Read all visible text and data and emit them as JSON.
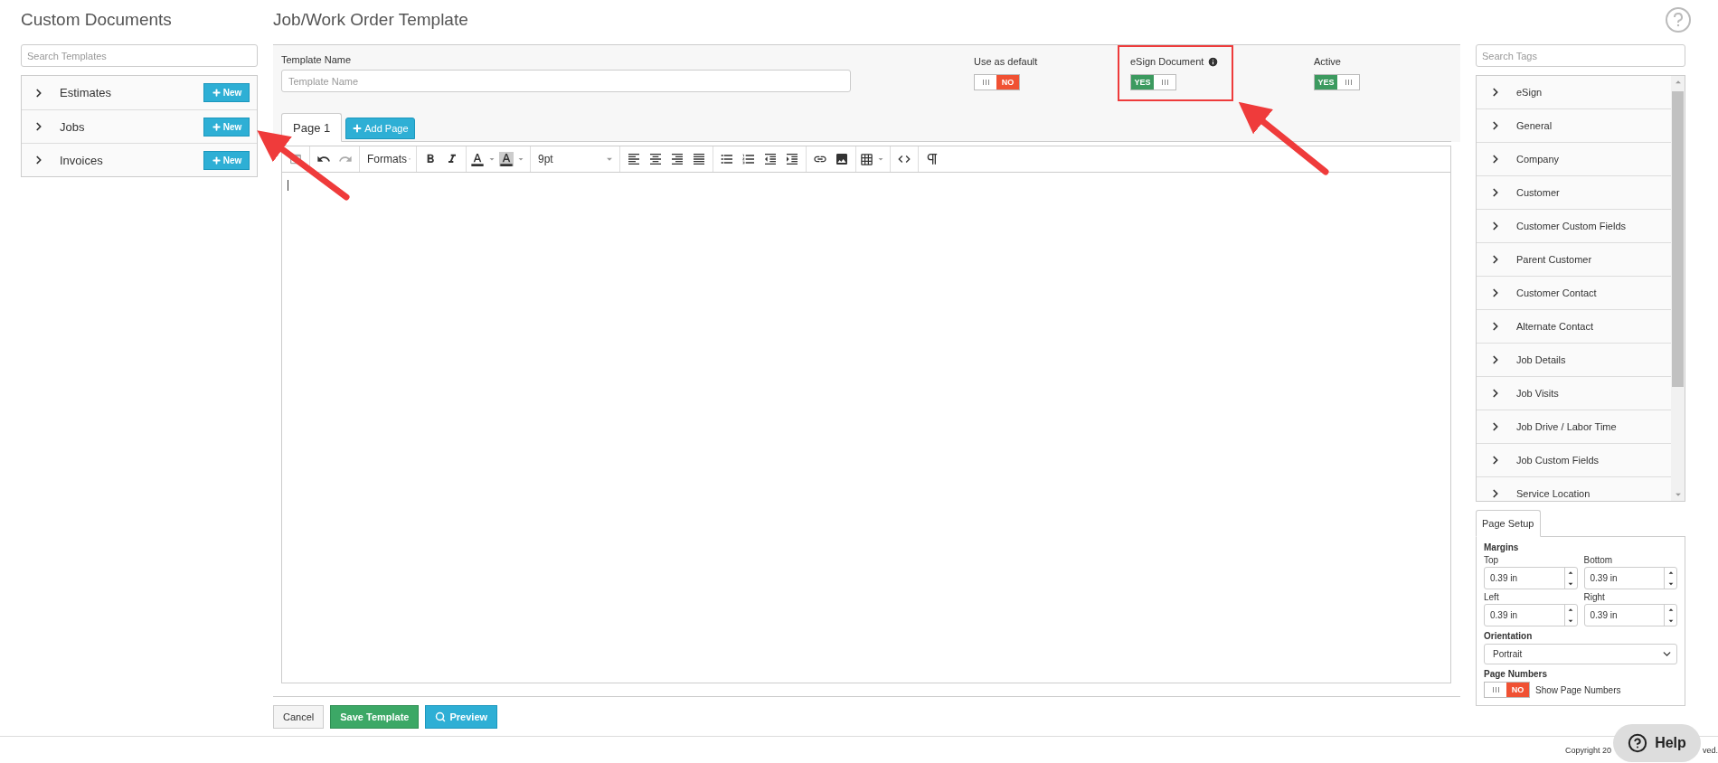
{
  "sidebar": {
    "title": "Custom Documents",
    "search": {
      "placeholder": "Search Templates"
    },
    "categories": [
      {
        "label": "Estimates",
        "button": "New",
        "expanded": false
      },
      {
        "label": "Jobs",
        "button": "New",
        "expanded": false
      },
      {
        "label": "Invoices",
        "button": "New",
        "expanded": false
      }
    ]
  },
  "editor": {
    "title": "Job/Work Order Template",
    "template_name": {
      "label": "Template Name",
      "placeholder": "Template Name"
    },
    "toggles": [
      {
        "label": "Use as default",
        "on": false,
        "text": "NO",
        "info": false,
        "highlighted": false
      },
      {
        "label": "eSign Document",
        "on": true,
        "text": "YES",
        "info": true,
        "highlighted": true
      },
      {
        "label": "Active",
        "on": true,
        "text": "YES",
        "info": false,
        "highlighted": false
      }
    ],
    "tabs": [
      {
        "label": "Page 1",
        "selected": true
      }
    ],
    "add_page": "Add Page",
    "toolbar": {
      "formats": "Formats",
      "font_size": "9pt"
    },
    "buttons": {
      "cancel": "Cancel",
      "save": "Save Template",
      "preview": "Preview"
    }
  },
  "tags": {
    "search": {
      "placeholder": "Search Tags"
    },
    "items": [
      {
        "label": "eSign",
        "expanded": false
      },
      {
        "label": "General",
        "expanded": false
      },
      {
        "label": "Company",
        "expanded": false
      },
      {
        "label": "Customer",
        "expanded": false
      },
      {
        "label": "Customer Custom Fields",
        "expanded": false
      },
      {
        "label": "Parent Customer",
        "expanded": false
      },
      {
        "label": "Customer Contact",
        "expanded": false
      },
      {
        "label": "Alternate Contact",
        "expanded": false
      },
      {
        "label": "Job Details",
        "expanded": false
      },
      {
        "label": "Job Visits",
        "expanded": false
      },
      {
        "label": "Job Drive / Labor Time",
        "expanded": false
      },
      {
        "label": "Job Custom Fields",
        "expanded": false
      },
      {
        "label": "Service Location",
        "expanded": false
      }
    ]
  },
  "page_setup": {
    "tab": "Page Setup",
    "margins_title": "Margins",
    "margins": [
      {
        "label": "Top",
        "value": "0.39 in"
      },
      {
        "label": "Bottom",
        "value": "0.39 in"
      },
      {
        "label": "Left",
        "value": "0.39 in"
      },
      {
        "label": "Right",
        "value": "0.39 in"
      }
    ],
    "orientation": {
      "label": "Orientation",
      "value": "Portrait"
    },
    "page_numbers": {
      "label": "Page Numbers",
      "toggle": {
        "on": false,
        "text": "NO"
      },
      "caption": "Show Page Numbers"
    }
  },
  "footer": {
    "copyright_parts": [
      "Copyright 20",
      "ved."
    ],
    "help": "Help"
  }
}
